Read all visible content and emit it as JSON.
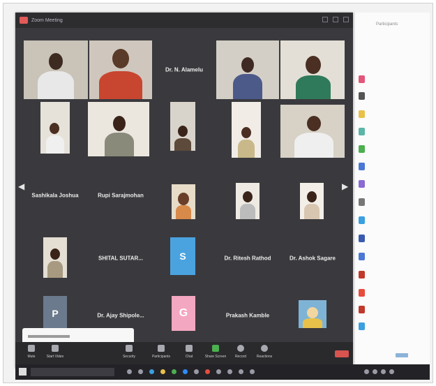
{
  "photo": {
    "corner_label": "",
    "page_mark": ""
  },
  "window": {
    "title": "Zoom Meeting"
  },
  "tiles": {
    "t1": {
      "name": ""
    },
    "t2": {
      "name": ""
    },
    "t3": {
      "center": "Dr. N. Alamelu"
    },
    "t4": {
      "name": ""
    },
    "t5": {
      "name": ""
    },
    "t6": {
      "name": ""
    },
    "t7": {
      "name": ""
    },
    "t8": {
      "name": ""
    },
    "t9": {
      "name": ""
    },
    "t10": {
      "name": ""
    },
    "t11": {
      "center": "Sashikala Joshua"
    },
    "t12": {
      "center": "Rupi Sarajmohan"
    },
    "t13": {
      "name": ""
    },
    "t14": {
      "name": ""
    },
    "t15": {
      "name": ""
    },
    "t16": {
      "name": ""
    },
    "t17": {
      "center": "SHITAL SUTAR..."
    },
    "t18": {
      "letter": "S",
      "name": ""
    },
    "t19": {
      "center": "Dr. Ritesh Rathod"
    },
    "t20": {
      "center": "Dr. Ashok Sagare"
    },
    "t21": {
      "letter": "P",
      "name": ""
    },
    "t22": {
      "center": "Dr. Ajay Shipole..."
    },
    "t23": {
      "letter": "G",
      "name": ""
    },
    "t24": {
      "center": "Prakash Kamble"
    },
    "t25": {
      "name": ""
    }
  },
  "toolbar": {
    "items": [
      {
        "label": "Mute",
        "icon": "microphone-icon"
      },
      {
        "label": "Start Video",
        "icon": "video-camera-icon"
      },
      {
        "label": "Security",
        "icon": "shield-icon"
      },
      {
        "label": "Participants",
        "icon": "participants-icon"
      },
      {
        "label": "Chat",
        "icon": "chat-icon"
      },
      {
        "label": "Share Screen",
        "icon": "share-screen-icon"
      },
      {
        "label": "Record",
        "icon": "record-icon"
      },
      {
        "label": "Reactions",
        "icon": "smiley-icon"
      }
    ],
    "end_label": ""
  },
  "side_panel": {
    "title": "Participants"
  },
  "taskbar": {
    "search_placeholder": "",
    "time": "",
    "date": ""
  },
  "colors": {
    "window_bg": "#3a3a3e",
    "toolbar_bg": "#2a2a2d",
    "end_red": "#d9534f",
    "avatar_s": "#4aa3df",
    "avatar_p": "#6b7a8c",
    "avatar_g": "#f4a7c0"
  }
}
